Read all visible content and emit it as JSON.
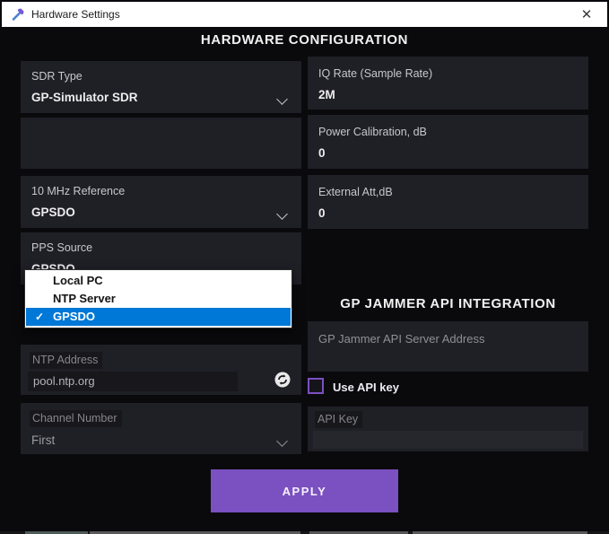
{
  "window": {
    "title": "Hardware Settings",
    "close_glyph": "✕"
  },
  "headings": {
    "main": "HARDWARE CONFIGURATION",
    "api": "GP JAMMER API INTEGRATION"
  },
  "left": {
    "sdr_type": {
      "label": "SDR Type",
      "value": "GP-Simulator SDR"
    },
    "ref_10mhz": {
      "label": "10 MHz Reference",
      "value": "GPSDO"
    },
    "pps_source": {
      "label": "PPS Source",
      "value": "GPSDO"
    },
    "pps_dropdown": {
      "items": [
        {
          "label": "Local PC",
          "selected": false
        },
        {
          "label": "NTP Server",
          "selected": false
        },
        {
          "label": "GPSDO",
          "selected": true
        }
      ],
      "check_glyph": "✓"
    },
    "ntp_address": {
      "label": "NTP Address",
      "value": "pool.ntp.org",
      "disabled": true
    },
    "channel_number": {
      "label": "Channel Number",
      "value": "First",
      "disabled": true
    }
  },
  "right": {
    "iq_rate": {
      "label": "IQ Rate (Sample Rate)",
      "value": "2M"
    },
    "power_calibration": {
      "label": "Power Calibration, dB",
      "value": "0"
    },
    "external_att": {
      "label": "External Att,dB",
      "value": "0"
    },
    "server_address": {
      "placeholder": "GP Jammer API Server Address",
      "value": ""
    },
    "use_api_key": {
      "label": "Use API key",
      "checked": false
    },
    "api_key": {
      "label": "API Key",
      "value": "",
      "disabled": true
    }
  },
  "apply": {
    "label": "APPLY"
  },
  "colors": {
    "accent_purple": "#7b50c0",
    "selection_blue": "#0078d7",
    "panel_bg": "#1f1f26",
    "dialog_bg": "#0a0a0d"
  }
}
